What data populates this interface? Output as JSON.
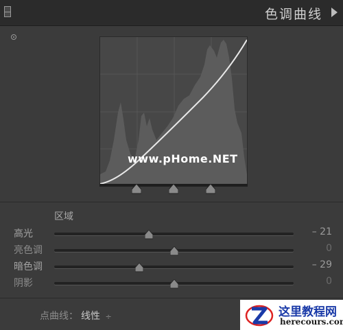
{
  "header": {
    "title": "色调曲线"
  },
  "watermark": "www.pHome.NET",
  "region": {
    "label": "区域",
    "sliders": [
      {
        "label": "高光",
        "value": "– 21",
        "level": -21,
        "zero": false
      },
      {
        "label": "亮色调",
        "value": "0",
        "level": 0,
        "zero": true
      },
      {
        "label": "暗色调",
        "value": "– 29",
        "level": -29,
        "zero": false
      },
      {
        "label": "阴影",
        "value": "0",
        "level": 0,
        "zero": true
      }
    ]
  },
  "split_points": [
    25,
    50,
    75
  ],
  "point_curve": {
    "label": "点曲线：",
    "value": "线性",
    "arrow": "÷"
  },
  "logo": {
    "cn": "这里教程网",
    "en": "herecours.com"
  }
}
